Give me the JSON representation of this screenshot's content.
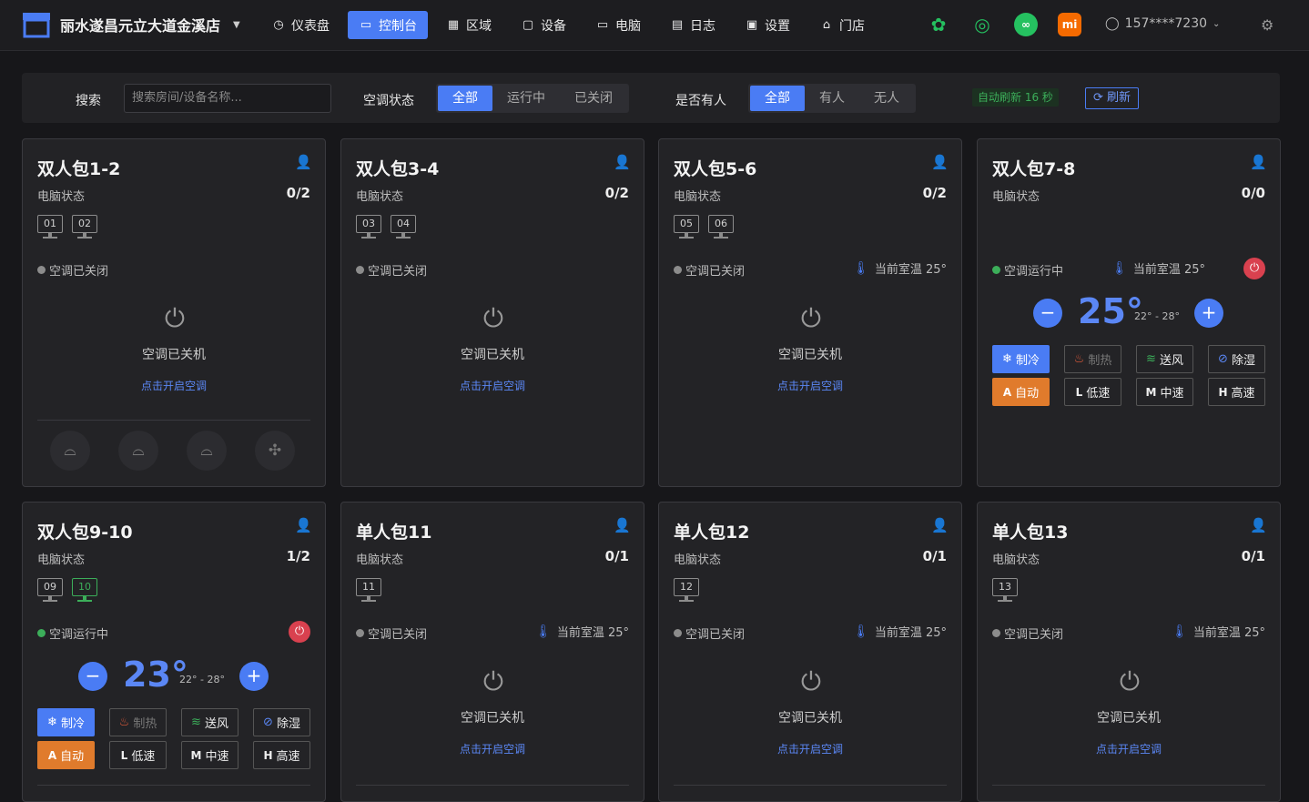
{
  "brand": {
    "name": "丽水遂昌元立大道金溪店"
  },
  "nav": [
    {
      "label": "仪表盘",
      "icon": "dashboard-icon"
    },
    {
      "label": "控制台",
      "icon": "console-icon",
      "active": true
    },
    {
      "label": "区域",
      "icon": "area-icon"
    },
    {
      "label": "设备",
      "icon": "device-icon"
    },
    {
      "label": "电脑",
      "icon": "computer-icon"
    },
    {
      "label": "日志",
      "icon": "log-icon"
    },
    {
      "label": "设置",
      "icon": "settings-icon"
    },
    {
      "label": "门店",
      "icon": "store-icon"
    }
  ],
  "ext_icons": {
    "mi": "mi"
  },
  "user": {
    "phone": "157****7230"
  },
  "filter": {
    "search_label": "搜索",
    "search_placeholder": "搜索房间/设备名称...",
    "ac_label": "空调状态",
    "ac_options": [
      "全部",
      "运行中",
      "已关闭"
    ],
    "occ_label": "是否有人",
    "occ_options": [
      "全部",
      "有人",
      "无人"
    ],
    "auto_refresh": "自动刷新 16 秒",
    "refresh": "刷新"
  },
  "common": {
    "pc_status_label": "电脑状态",
    "ac_off": "空调已关闭",
    "ac_on": "空调运行中",
    "ac_shutdown": "空调已关机",
    "open_ac": "点击开启空调",
    "room_temp_prefix": "当前室温",
    "range": "22° - 28°",
    "modes": [
      "制冷",
      "制热",
      "送风",
      "除湿"
    ],
    "speeds": [
      {
        "k": "A",
        "l": "自动"
      },
      {
        "k": "L",
        "l": "低速"
      },
      {
        "k": "M",
        "l": "中速"
      },
      {
        "k": "H",
        "l": "高速"
      }
    ]
  },
  "rooms": [
    {
      "name": "双人包1-2",
      "pc_count": "0/2",
      "pcs": [
        "01",
        "02"
      ],
      "pcs_on": [],
      "running": false,
      "occupied": false,
      "room_temp": null
    },
    {
      "name": "双人包3-4",
      "pc_count": "0/2",
      "pcs": [
        "03",
        "04"
      ],
      "pcs_on": [],
      "running": false,
      "occupied": false,
      "room_temp": null
    },
    {
      "name": "双人包5-6",
      "pc_count": "0/2",
      "pcs": [
        "05",
        "06"
      ],
      "pcs_on": [],
      "running": false,
      "occupied": false,
      "room_temp": "25°"
    },
    {
      "name": "双人包7-8",
      "pc_count": "0/0",
      "pcs": [],
      "pcs_on": [],
      "running": true,
      "occupied": false,
      "room_temp": "25°",
      "set_temp": "25°"
    },
    {
      "name": "双人包9-10",
      "pc_count": "1/2",
      "pcs": [
        "09",
        "10"
      ],
      "pcs_on": [
        "10"
      ],
      "running": true,
      "occupied": true,
      "room_temp": null,
      "set_temp": "23°"
    },
    {
      "name": "单人包11",
      "pc_count": "0/1",
      "pcs": [
        "11"
      ],
      "pcs_on": [],
      "running": false,
      "occupied": false,
      "room_temp": "25°"
    },
    {
      "name": "单人包12",
      "pc_count": "0/1",
      "pcs": [
        "12"
      ],
      "pcs_on": [],
      "running": false,
      "occupied": false,
      "room_temp": "25°"
    },
    {
      "name": "单人包13",
      "pc_count": "0/1",
      "pcs": [
        "13"
      ],
      "pcs_on": [],
      "running": false,
      "occupied": false,
      "room_temp": "25°"
    }
  ],
  "colors": {
    "accent": "#4a7cf4",
    "green": "#3cae5a",
    "red": "#d9414f",
    "orange": "#e07b2c"
  }
}
